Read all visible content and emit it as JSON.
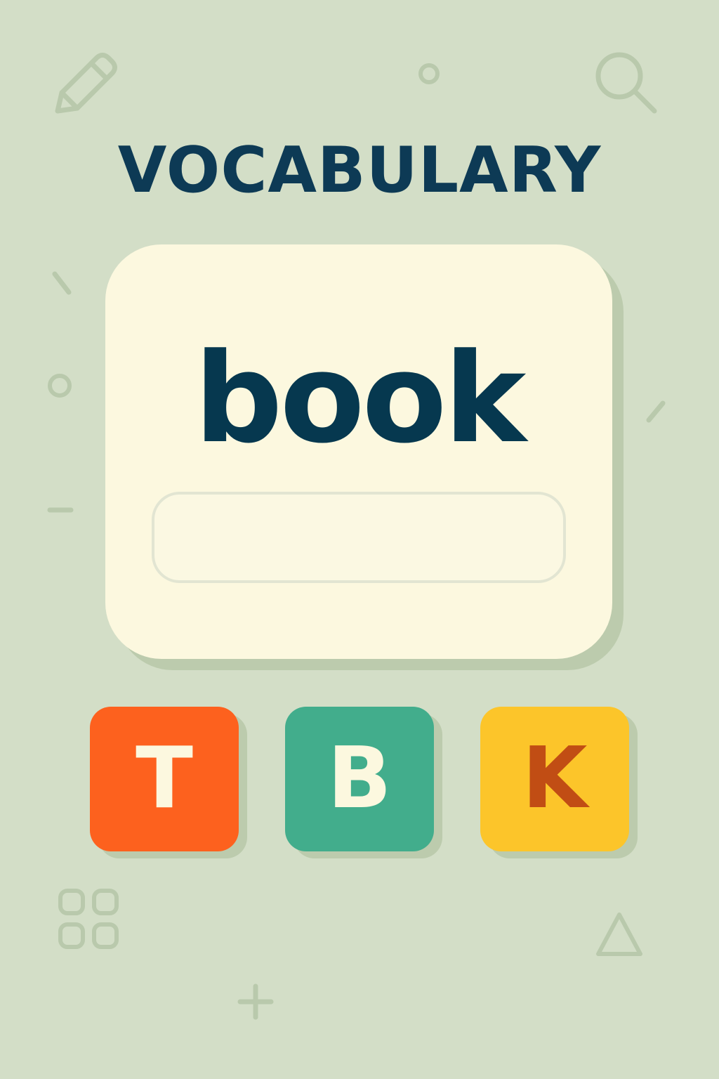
{
  "title": "VOCABULARY",
  "card": {
    "word": "book",
    "answer_value": "",
    "answer_placeholder": ""
  },
  "tiles": [
    {
      "letter": "T",
      "color": "#fd611e",
      "text_color": "#fcf8df"
    },
    {
      "letter": "B",
      "color": "#42ad8c",
      "text_color": "#fcf8df"
    },
    {
      "letter": "K",
      "color": "#fcc52a",
      "text_color": "#c14d14"
    }
  ],
  "colors": {
    "background": "#d3dec7",
    "title": "#0d3a55",
    "card": "#fcf8df",
    "decoration": "#b9c9ac"
  },
  "decorations": [
    "pencil-icon",
    "small-circle-icon",
    "search-icon",
    "dash-icon",
    "circle-icon",
    "minus-icon",
    "grid-icon",
    "triangle-icon",
    "plus-icon"
  ]
}
